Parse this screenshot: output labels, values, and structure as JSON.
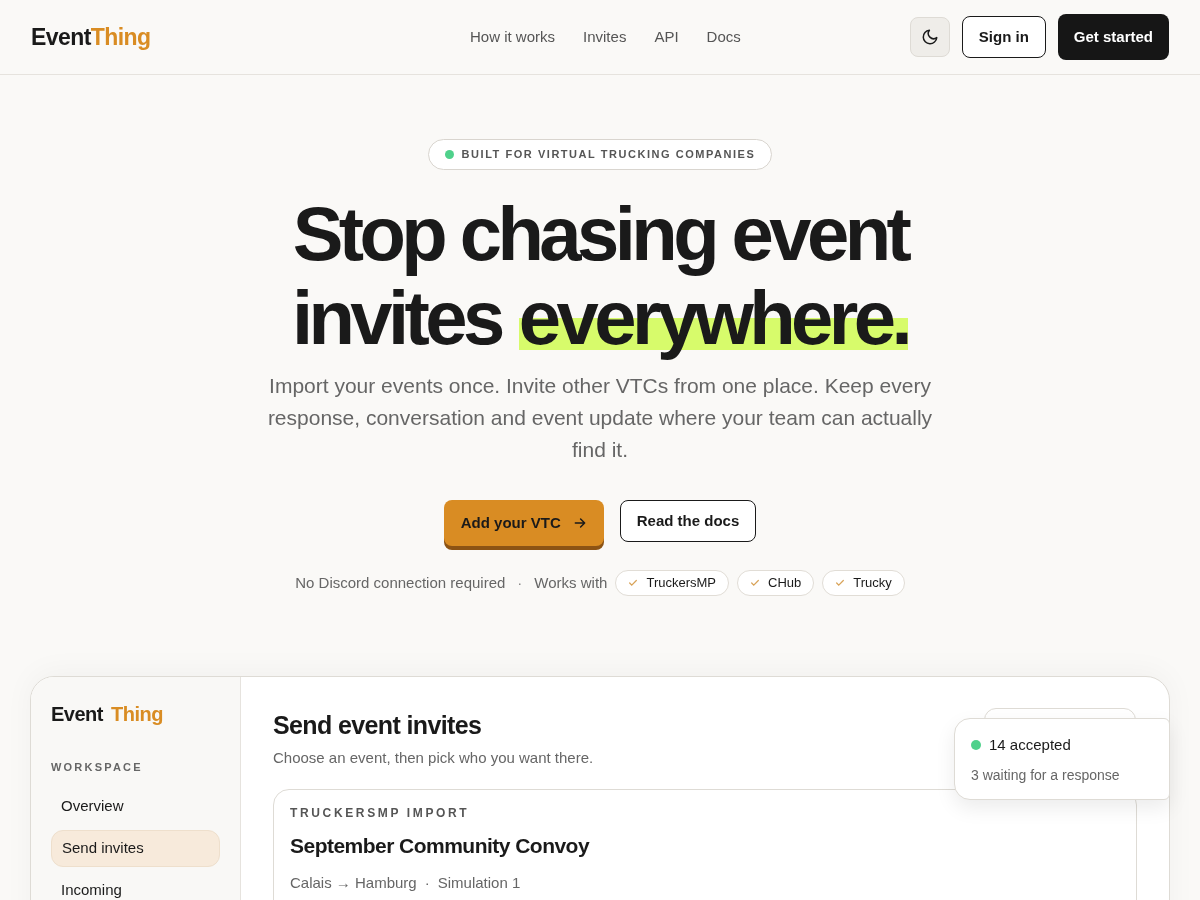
{
  "nav": {
    "logo": {
      "first": "Event",
      "second": "Thing"
    },
    "links": [
      "How it works",
      "Invites",
      "API",
      "Docs"
    ],
    "sign_in": "Sign in",
    "get_started": "Get started"
  },
  "hero": {
    "badge": "BUILT FOR VIRTUAL TRUCKING COMPANIES",
    "headline": {
      "line_1": "Stop chasing event",
      "line_2": "invites",
      "highlight": "everywhere."
    },
    "lead": "Import your events once. Invite other VTCs from one place. Keep every response, conversation and event update where your team can actually find it.",
    "primary_button": "Add your VTC",
    "secondary_button": "Read the docs",
    "note": "No Discord connection required",
    "separator": "·",
    "works_with": "Works with",
    "integrations": [
      "TruckersMP",
      "CHub",
      "Trucky"
    ]
  },
  "app": {
    "logo": {
      "first": "Event",
      "second": "Thing"
    },
    "section": "WORKSPACE",
    "items": [
      {
        "label": "Overview",
        "selected": false
      },
      {
        "label": "Send invites",
        "selected": true
      },
      {
        "label": "Incoming",
        "selected": false
      }
    ],
    "title": "Send event invites",
    "subtitle": "Choose an event, then pick who you want there.",
    "event": {
      "source": "TRUCKERSMP IMPORT",
      "name": "September Community Convoy",
      "route": "Calais → Hamburg",
      "separator": "·",
      "server": "Simulation 1"
    },
    "toast": {
      "accepted": "14 accepted",
      "waiting": "3 waiting for a response"
    }
  }
}
